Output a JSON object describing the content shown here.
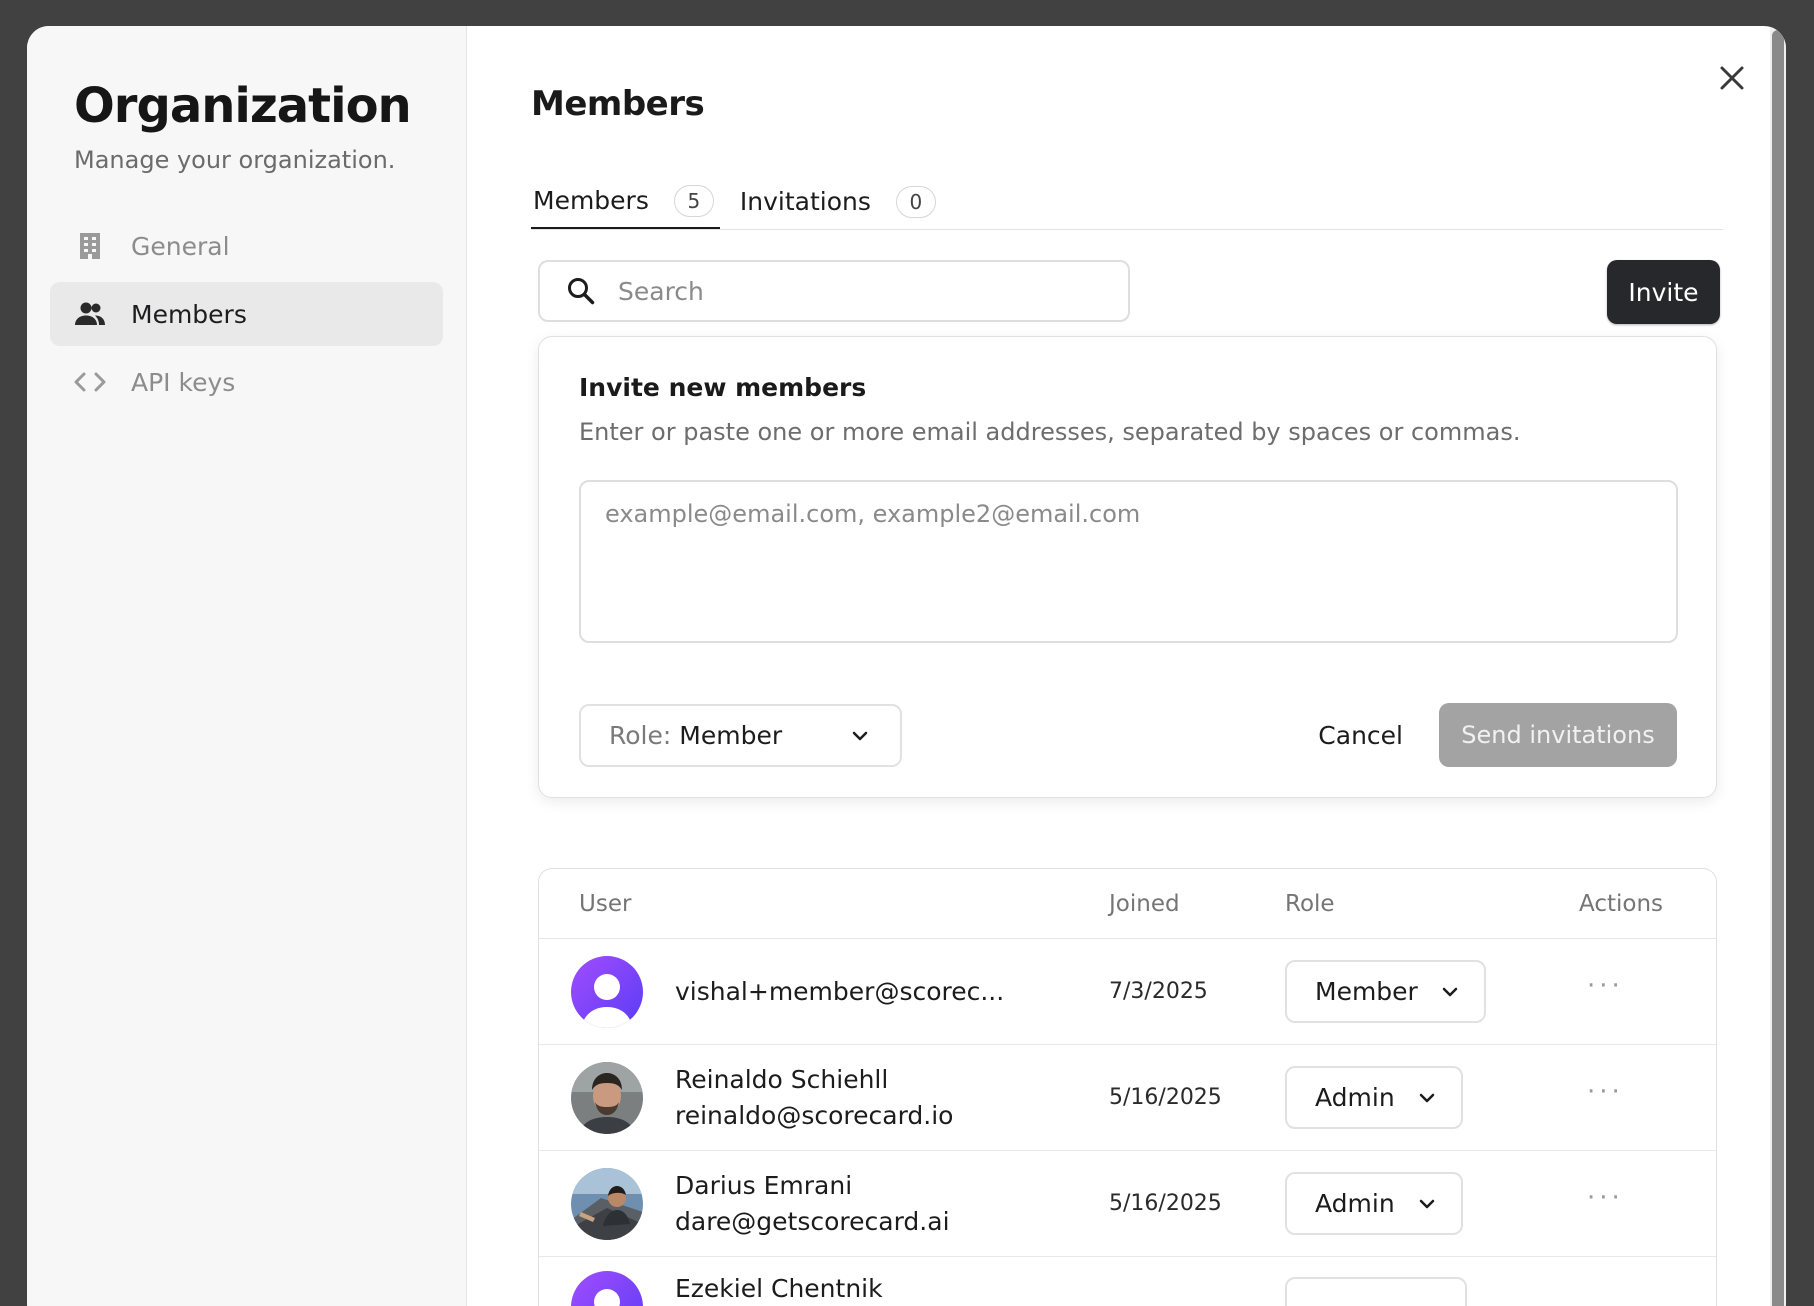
{
  "sidebar": {
    "title": "Organization",
    "subtitle": "Manage your organization.",
    "items": [
      {
        "label": "General",
        "icon": "building-icon",
        "active": false
      },
      {
        "label": "Members",
        "icon": "users-icon",
        "active": true
      },
      {
        "label": "API keys",
        "icon": "code-icon",
        "active": false
      }
    ]
  },
  "main": {
    "title": "Members",
    "tabs": [
      {
        "label": "Members",
        "count": "5"
      },
      {
        "label": "Invitations",
        "count": "0"
      }
    ],
    "search": {
      "placeholder": "Search",
      "value": ""
    },
    "invite_label": "Invite"
  },
  "invite_panel": {
    "title": "Invite new members",
    "description": "Enter or paste one or more email addresses, separated by spaces or commas.",
    "emails_placeholder": "example@email.com, example2@email.com",
    "role_prefix": "Role:",
    "role_value": "Member",
    "cancel_label": "Cancel",
    "send_label": "Send invitations"
  },
  "table": {
    "headers": {
      "user": "User",
      "joined": "Joined",
      "role": "Role",
      "actions": "Actions"
    },
    "rows": [
      {
        "name": "",
        "email": "vishal+member@scorec...",
        "joined": "7/3/2025",
        "role": "Member",
        "avatar": "default-avatar"
      },
      {
        "name": "Reinaldo Schiehll",
        "email": "reinaldo@scorecard.io",
        "joined": "5/16/2025",
        "role": "Admin",
        "avatar": "photo-avatar"
      },
      {
        "name": "Darius Emrani",
        "email": "dare@getscorecard.ai",
        "joined": "5/16/2025",
        "role": "Admin",
        "avatar": "photo-avatar"
      },
      {
        "name": "Ezekiel Chentnik",
        "email": "",
        "joined": "",
        "role": "",
        "avatar": "default-avatar"
      }
    ],
    "actions_glyph": "···"
  },
  "colors": {
    "backdrop": "#414141",
    "primary_button": "#27282b",
    "disabled_button": "#a3a3a3",
    "avatar_gradient_start": "#9b4dff",
    "avatar_gradient_end": "#5b3df5"
  }
}
